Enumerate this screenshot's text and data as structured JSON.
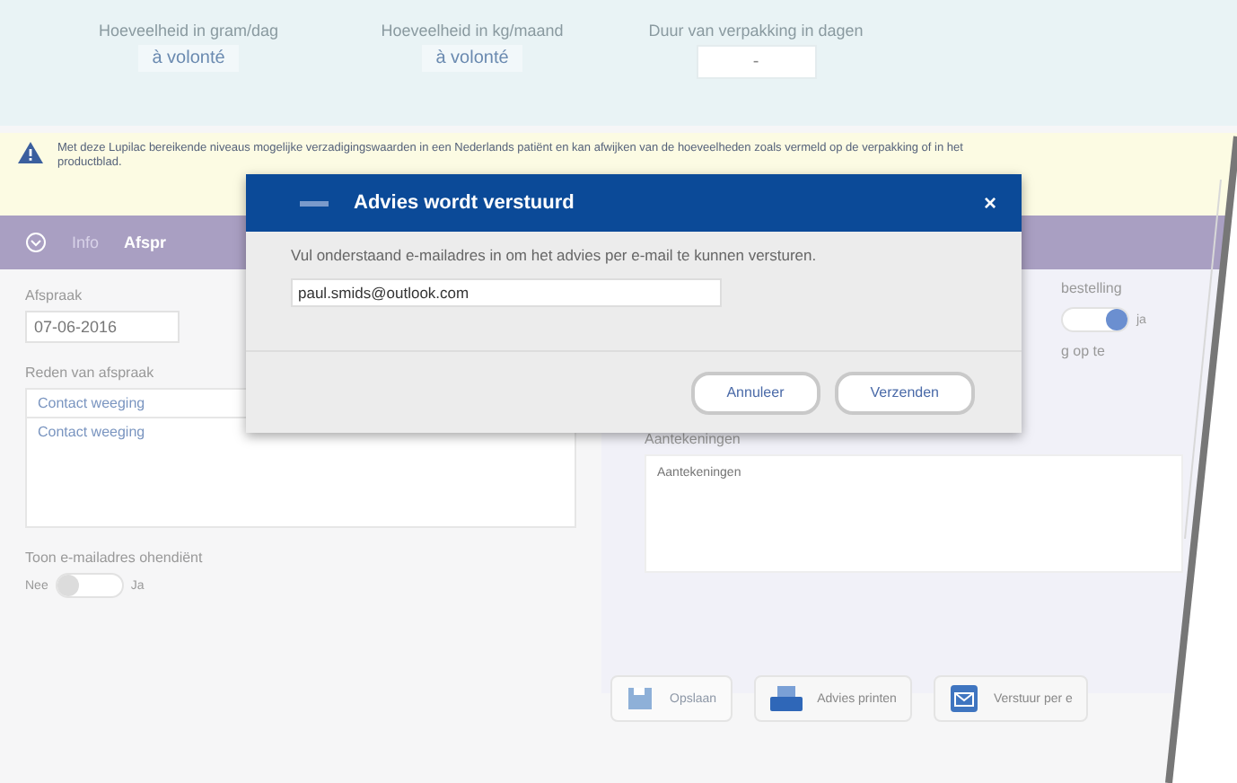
{
  "header_fields": [
    {
      "label": "Hoeveelheid in gram/dag",
      "value": "à volonté",
      "kind": "text"
    },
    {
      "label": "Hoeveelheid in kg/maand",
      "value": "à volonté",
      "kind": "text"
    },
    {
      "label": "Duur van verpakking in dagen",
      "value": "-",
      "kind": "select"
    }
  ],
  "warning": {
    "text": "Met deze Lupilac bereikende niveaus mogelijke verzadigingswaarden in een Nederlands patiënt en kan afwijken van de hoeveelheden zoals vermeld op de verpakking of in het productblad."
  },
  "section_bar": {
    "tabs": [
      {
        "label": "Info",
        "selected": false
      },
      {
        "label": "Afspr",
        "selected": true
      }
    ]
  },
  "left_panel": {
    "date_label": "Afspraak",
    "date_value": "07-06-2016",
    "reason_label": "Reden van afspraak",
    "reason_select": "Contact weeging",
    "reason_text": "Contact weeging",
    "email_toggle": {
      "label": "Toon e-mailadres ohendiënt",
      "off_label": "Nee",
      "on_label": "Ja",
      "on": false
    }
  },
  "right_panel": {
    "order_label": "bestelling",
    "order_toggle": {
      "on": true,
      "on_label": "ja"
    },
    "extra_text": "g op te",
    "notes_label": "Aantekeningen",
    "notes_placeholder": "Aantekeningen"
  },
  "actions": [
    {
      "label": "Opslaan",
      "disabled": true,
      "kind": "save"
    },
    {
      "label": "Advies printen",
      "disabled": false,
      "kind": "print"
    },
    {
      "label": "Verstuur per e",
      "disabled": false,
      "kind": "mail"
    }
  ],
  "dialog": {
    "title": "Advies wordt verstuurd",
    "close": "×",
    "message": "Vul onderstaand e-mailadres in om het advies per e-mail te kunnen versturen.",
    "email": "paul.smids@outlook.com",
    "buttons": [
      "Annuleer",
      "Verzenden"
    ]
  }
}
